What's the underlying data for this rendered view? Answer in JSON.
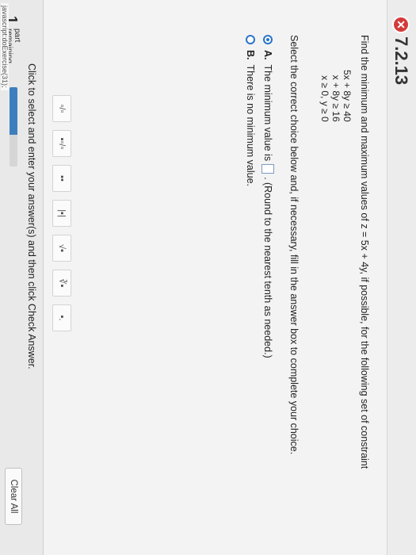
{
  "header": {
    "exercise_id": "7.2.13",
    "status_icon": "x-mark-icon",
    "status_symbol": "✕"
  },
  "question": {
    "prompt": "Find the minimum and maximum values of z = 5x + 4y, if possible, for the following set of constraint",
    "constraints": [
      "5x + 8y ≥ 40",
      "x + 8y ≥ 16",
      "x ≥ 0, y ≥ 0"
    ],
    "instruction": "Select the correct choice below and, if necessary, fill in the answer box to complete your choice."
  },
  "choices": [
    {
      "letter": "A.",
      "text_before": "The minimum value is",
      "text_after": ". (Round to the nearest tenth as needed.)",
      "selected": true
    },
    {
      "letter": "B.",
      "text": "There is no minimum value.",
      "selected": false
    }
  ],
  "palette": [
    {
      "icon": "fraction-icon",
      "symbol": "▫/▫"
    },
    {
      "icon": "mixed-number-icon",
      "symbol": "▪▫/▫"
    },
    {
      "icon": "exponent-icon",
      "symbol": "▪•"
    },
    {
      "icon": "absolute-value-icon",
      "symbol": "|▪|"
    },
    {
      "icon": "square-root-icon",
      "symbol": "√▪"
    },
    {
      "icon": "nth-root-icon",
      "symbol": "∛▪"
    },
    {
      "icon": "decimal-icon",
      "symbol": "▪."
    }
  ],
  "footer": {
    "instruction": "Click to select and enter your answer(s) and then click Check Answer.",
    "parts_count": "1",
    "parts_label_1": "part",
    "parts_label_2": "remaining",
    "progress": 0.6,
    "status_url": "javascript:doExercise(31);",
    "clear_all_label": "Clear All"
  }
}
